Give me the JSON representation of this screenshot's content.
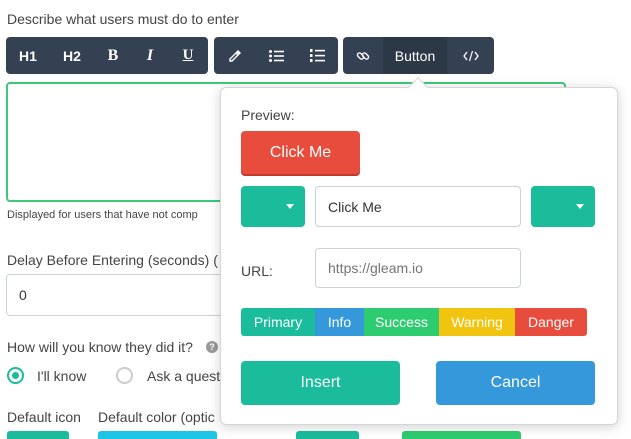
{
  "form": {
    "entry_label": "Describe what users must do to enter",
    "help_text": "Displayed for users that have not comp",
    "delay_label": "Delay Before Entering (seconds) (",
    "delay_value": "0",
    "verify_label": "How will you know they did it?",
    "radio_know": "I'll know",
    "radio_ask": "Ask a quest",
    "default_icon_label": "Default icon",
    "default_color_label": "Default color (optic"
  },
  "toolbar": {
    "h1": "H1",
    "h2": "H2",
    "bold": "B",
    "italic": "I",
    "underline": "U",
    "button": "Button"
  },
  "popover": {
    "preview_label": "Preview:",
    "preview_button": "Click Me",
    "text_value": "Click Me",
    "url_label": "URL:",
    "url_placeholder": "https://gleam.io",
    "styles": [
      {
        "label": "Primary",
        "color": "#1abc9c"
      },
      {
        "label": "Info",
        "color": "#3498db"
      },
      {
        "label": "Success",
        "color": "#2ecc71"
      },
      {
        "label": "Warning",
        "color": "#f1c40f"
      },
      {
        "label": "Danger",
        "color": "#e74c3c"
      }
    ],
    "insert_label": "Insert",
    "cancel_label": "Cancel"
  },
  "colors": {
    "toolbar_bg": "#344152",
    "accent_teal": "#1abc9c",
    "editor_border": "#3ec97a",
    "preview_red": "#e74c3c",
    "cancel_blue": "#3498db",
    "swatch_cyan": "#1cc4e6",
    "swatch_green": "#2ecc71"
  }
}
